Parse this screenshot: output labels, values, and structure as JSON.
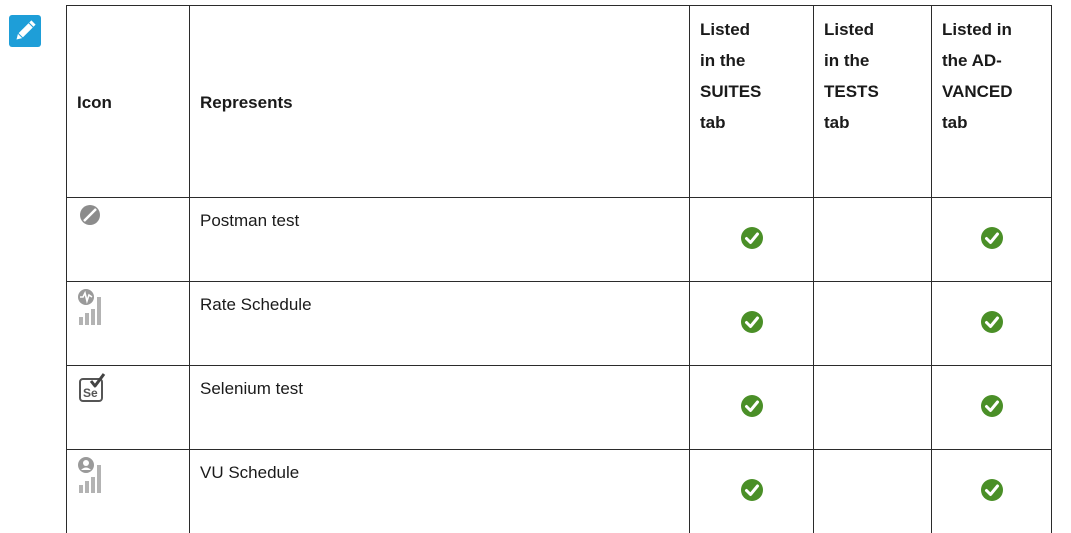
{
  "note_icon": "pencil-note-icon",
  "table": {
    "headers": [
      "Icon",
      "Represents",
      "Listed in the SUITES tab",
      "Listed in the TESTS tab",
      "Listed in the AD-VANCED tab"
    ],
    "header_lines": {
      "suites": [
        "Listed",
        "in the",
        "SUITES",
        "tab"
      ],
      "tests": [
        "Listed",
        "in the",
        "TESTS",
        "tab"
      ],
      "advanced": [
        "Listed in",
        "the AD-",
        "VANCED",
        "tab"
      ]
    },
    "rows": [
      {
        "icon": "postman-icon",
        "represents": "Postman test",
        "suites": true,
        "tests": false,
        "advanced": true
      },
      {
        "icon": "rate-schedule-icon",
        "represents": "Rate Schedule",
        "suites": true,
        "tests": false,
        "advanced": true
      },
      {
        "icon": "selenium-icon",
        "represents": "Selenium test",
        "suites": true,
        "tests": false,
        "advanced": true
      },
      {
        "icon": "vu-schedule-icon",
        "represents": "VU Schedule",
        "suites": true,
        "tests": false,
        "advanced": true
      }
    ]
  },
  "colors": {
    "note_blue": "#1e9ed8",
    "check_green": "#4a8f27",
    "icon_gray": "#9a9a9a"
  }
}
